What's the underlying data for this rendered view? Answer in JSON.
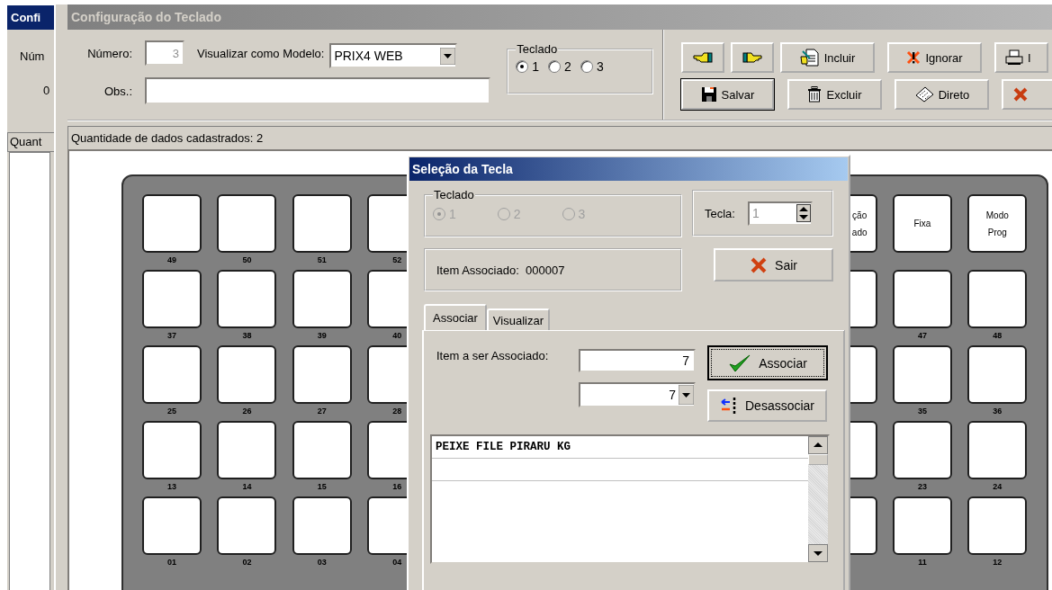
{
  "back_window": {
    "title": "Confi",
    "label": "Núm",
    "value": "0",
    "column_header": "Quant"
  },
  "window": {
    "title": "Configuração do Teclado"
  },
  "form": {
    "numero_label": "Número:",
    "numero_value": "3",
    "numero_disabled": true,
    "modelo_label": "Visualizar como Modelo:",
    "modelo_value": "PRIX4 WEB",
    "obs_label": "Obs.:"
  },
  "teclado": {
    "title": "Teclado",
    "options": [
      {
        "label": "1",
        "selected": true
      },
      {
        "label": "2",
        "selected": false
      },
      {
        "label": "3",
        "selected": false
      }
    ]
  },
  "toolbar": [
    [
      {
        "default": false
      },
      {
        "default": false
      },
      {
        "label": "Incluir",
        "default": false
      },
      {
        "label": "Ignorar",
        "default": false
      },
      {
        "label": "I",
        "default": false
      }
    ],
    [
      {
        "label": "Salvar",
        "default": true
      },
      {
        "label": "Excluir",
        "default": false
      },
      {
        "label": "Direto",
        "default": false
      },
      {
        "default": false
      }
    ]
  ],
  "status": "Quantidade de dados cadastrados: 2",
  "keyboard": {
    "rows": [
      {
        "left": [
          {
            "label": "49"
          },
          {
            "label": "50"
          },
          {
            "label": "51"
          },
          {
            "label": "52"
          }
        ],
        "right": [
          {
            "kind": "clipped",
            "lines": [
              "ção",
              "ado"
            ]
          },
          {
            "lines": [
              "Fixa"
            ]
          },
          {
            "lines": [
              "Modo",
              "Prog"
            ]
          }
        ]
      },
      {
        "left": [
          {
            "label": "37"
          },
          {
            "label": "38"
          },
          {
            "label": "39"
          },
          {
            "label": "40"
          }
        ],
        "right": [
          {
            "kind": "clipped"
          },
          {
            "label": "47"
          },
          {
            "label": "48"
          }
        ]
      },
      {
        "left": [
          {
            "label": "25"
          },
          {
            "label": "26"
          },
          {
            "label": "27"
          },
          {
            "label": "28"
          }
        ],
        "right": [
          {
            "kind": "clipped"
          },
          {
            "label": "35"
          },
          {
            "label": "36"
          }
        ]
      },
      {
        "left": [
          {
            "label": "13"
          },
          {
            "label": "14"
          },
          {
            "label": "15"
          },
          {
            "label": "16"
          }
        ],
        "right": [
          {
            "kind": "clipped"
          },
          {
            "label": "23"
          },
          {
            "label": "24"
          }
        ]
      },
      {
        "left": [
          {
            "label": "01"
          },
          {
            "label": "02"
          },
          {
            "label": "03"
          },
          {
            "label": "04"
          }
        ],
        "right": [
          {
            "kind": "clipped"
          },
          {
            "label": "11"
          },
          {
            "label": "12"
          }
        ]
      }
    ]
  },
  "dialog": {
    "title": "Seleção da Tecla",
    "teclado": {
      "title": "Teclado",
      "disabled": true,
      "options": [
        {
          "label": "1",
          "selected": true
        },
        {
          "label": "2",
          "selected": false
        },
        {
          "label": "3",
          "selected": false
        }
      ]
    },
    "tecla_label": "Tecla:",
    "tecla_value": "1",
    "tecla_disabled": true,
    "item_label": "Item Associado:",
    "item_value": "000007",
    "sair": "Sair",
    "tabs": [
      {
        "label": "Associar",
        "selected": true
      },
      {
        "label": "Visualizar",
        "selected": false
      }
    ],
    "associar_label": "Item a ser Associado:",
    "item_field": "7",
    "item_combo": "7",
    "associar_button": {
      "label": "Associar",
      "focused": true
    },
    "desassociar": "Desassociar",
    "list": [
      "PEIXE FILE PIRARU KG"
    ]
  }
}
